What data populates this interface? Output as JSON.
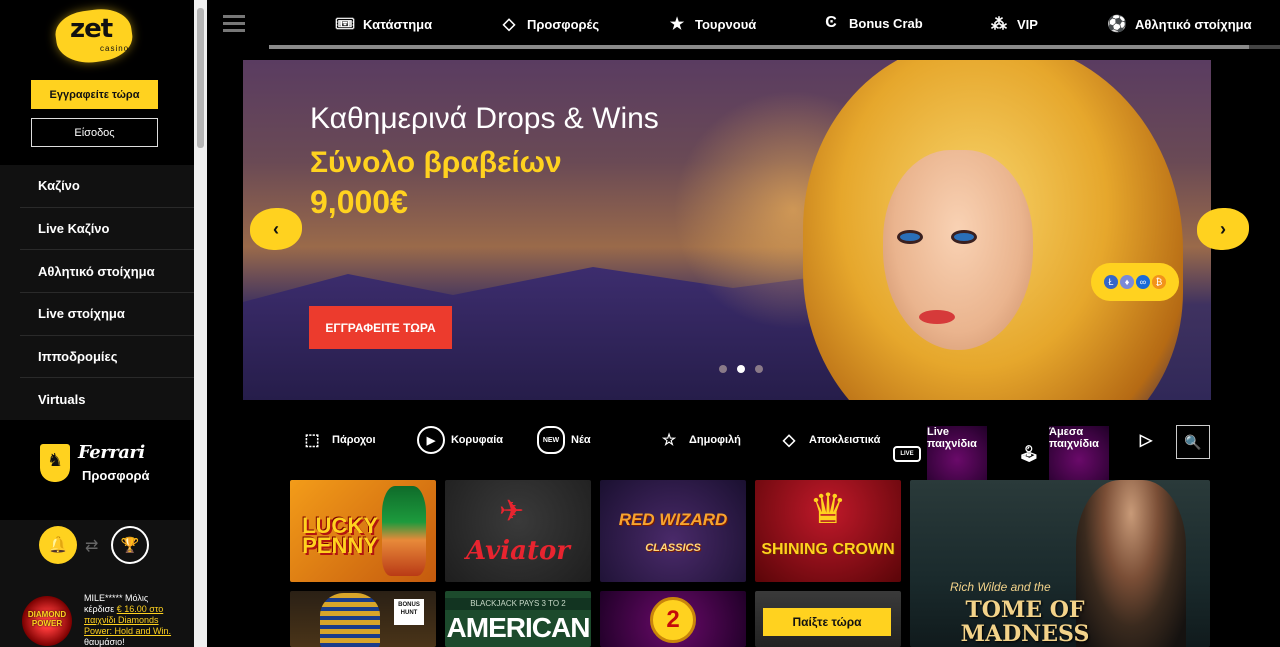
{
  "brand": {
    "logo_main": "zet",
    "logo_sub": "casino",
    "accent": "#ffd21f"
  },
  "auth": {
    "register_label": "Εγγραφείτε τώρα",
    "login_label": "Είσοδος"
  },
  "sidebar": {
    "items": [
      {
        "label": "Καζίνο"
      },
      {
        "label": "Live Καζίνο"
      },
      {
        "label": "Αθλητικό στοίχημα"
      },
      {
        "label": "Live στοίχημα"
      },
      {
        "label": "Ιπποδρομίες"
      },
      {
        "label": "Virtuals"
      }
    ],
    "promo": {
      "brand": "Ferrari",
      "label": "Προσφορά"
    },
    "recent_win": {
      "game_logo": "DIAMOND POWER",
      "user": "MILE*****",
      "text_before": "Μόλις κέρδισε",
      "amount_link": "€ 16.00 στο παιχνίδι Diamonds Power: Hold and Win.",
      "text_after": "θαυμάσιο!"
    }
  },
  "topnav": {
    "items": [
      {
        "label": "Κατάστημα",
        "icon": "ticket-icon"
      },
      {
        "label": "Προσφορές",
        "icon": "diamond-icon"
      },
      {
        "label": "Τουρνουά",
        "icon": "star-icon"
      },
      {
        "label": "Bonus Crab",
        "icon": "crab-claw-icon"
      },
      {
        "label": "VIP",
        "icon": "stars-icon"
      },
      {
        "label": "Αθλητικό στοίχημα",
        "icon": "soccer-ball-icon"
      }
    ]
  },
  "hero": {
    "headline": "Καθημερινά Drops & Wins",
    "subheadline": "Σύνολο βραβείων",
    "amount": "9,000€",
    "cta_label": "ΕΓΓΡΑΦΕΙΤΕ ΤΩΡΑ",
    "slides_count": 3,
    "active_slide": 2
  },
  "categories": [
    {
      "label": "Πάροχοι",
      "icon": "providers-icon"
    },
    {
      "label": "Κορυφαία",
      "icon": "play-circle-icon"
    },
    {
      "label": "Νέα",
      "icon": "new-badge-icon",
      "badge": "NEW"
    },
    {
      "label": "Δημοφιλή",
      "icon": "star-icon"
    },
    {
      "label": "Αποκλειστικά",
      "icon": "diamond-icon"
    },
    {
      "label": "Live παιχνίδια",
      "icon": "live-tv-icon",
      "badge": "LIVE"
    },
    {
      "label": "Άμεσα παιχνίδια",
      "icon": "joystick-icon"
    }
  ],
  "games": {
    "lucky_penny": "LUCKY PENNY",
    "aviator": "Aviator",
    "red_wizard": "RED WIZARD",
    "red_wizard_sub": "CLASSICS",
    "shining_crown": "SHINING CROWN",
    "tome_small": "Rich Wilde and the",
    "tome_title": "TOME OF MADNESS",
    "bonus_hunt": "BONUS HUNT",
    "american_top": "BLACKJACK PAYS 3 TO 2",
    "american": "AMERICAN BLACKJACK",
    "two_coin": "2",
    "play_now": "Παίξτε τώρα"
  }
}
